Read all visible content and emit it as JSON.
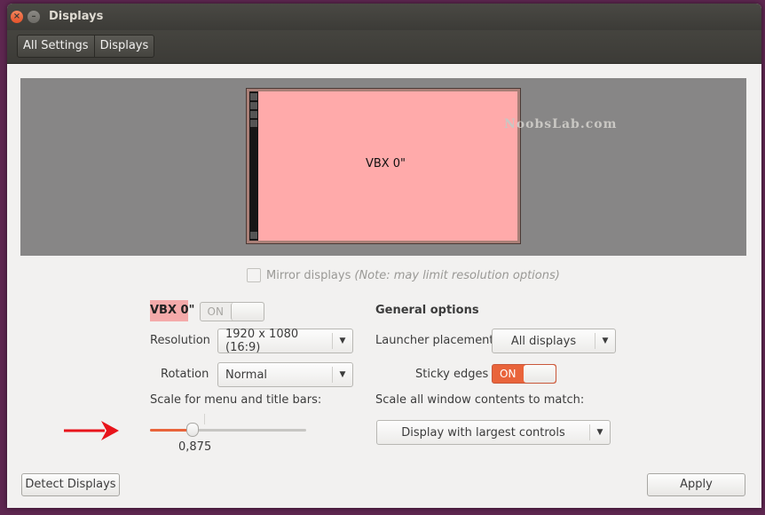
{
  "window": {
    "title": "Displays",
    "close_glyph": "×",
    "minimize_glyph": "–"
  },
  "breadcrumb": [
    "All Settings",
    "Displays"
  ],
  "watermark": "NoobsLab.com",
  "arrangement": {
    "monitor_label": "VBX 0\""
  },
  "mirror": {
    "label": "Mirror displays",
    "note": "(Note: may limit resolution options)",
    "checked": false
  },
  "display": {
    "name": "VBX 0\"",
    "toggle_label": "ON",
    "toggle_on": false,
    "resolution_label": "Resolution",
    "resolution_value": "1920 x 1080 (16:9)",
    "rotation_label": "Rotation",
    "rotation_value": "Normal",
    "scale_label": "Scale for menu and title bars:",
    "scale_value": "0,875",
    "scale_fraction": 0.27
  },
  "general": {
    "heading": "General options",
    "launcher_label": "Launcher placement",
    "launcher_value": "All displays",
    "sticky_label": "Sticky edges",
    "sticky_toggle_label": "ON",
    "sticky_on": true,
    "scale_all_label": "Scale all window contents to match:",
    "scale_all_value": "Display with largest controls"
  },
  "buttons": {
    "detect": "Detect Displays",
    "apply": "Apply"
  },
  "colors": {
    "accent": "#e9643b",
    "monitor_fill": "#ffaaaa",
    "annotation_arrow": "#e8141b"
  },
  "icons": {
    "dropdown": "▼"
  }
}
